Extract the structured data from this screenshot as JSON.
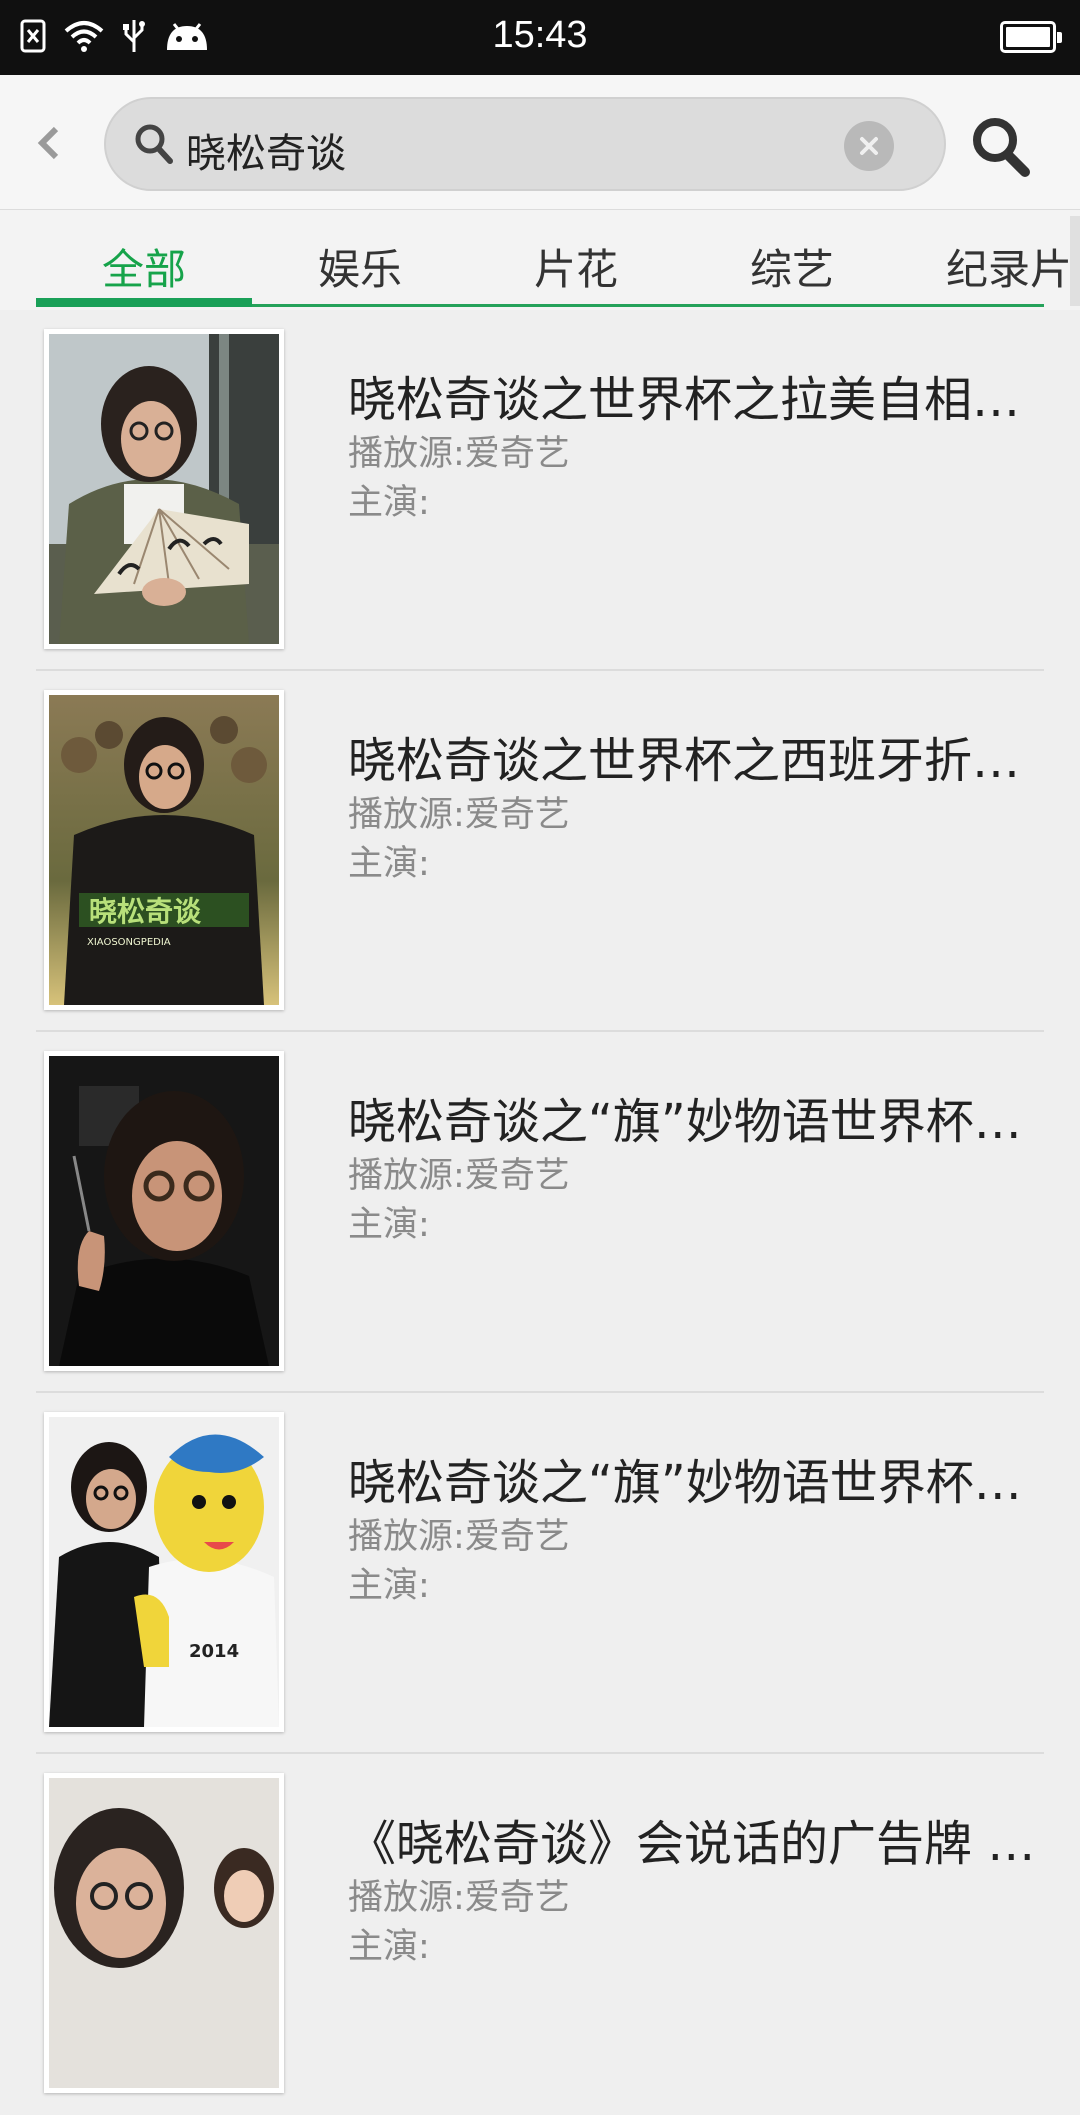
{
  "status_bar": {
    "time": "15:43",
    "icons": [
      "notification-blocked-icon",
      "wifi-icon",
      "usb-icon",
      "android-icon",
      "battery-icon"
    ]
  },
  "search": {
    "query": "晓松奇谈"
  },
  "tabs": [
    {
      "label": "全部",
      "active": true
    },
    {
      "label": "娱乐",
      "active": false
    },
    {
      "label": "片花",
      "active": false
    },
    {
      "label": "综艺",
      "active": false
    },
    {
      "label": "纪录片",
      "active": false
    }
  ],
  "results": [
    {
      "title": "晓松奇谈之世界杯之拉美自相…",
      "source": "播放源:爱奇艺",
      "cast": "主演:"
    },
    {
      "title": "晓松奇谈之世界杯之西班牙折…",
      "source": "播放源:爱奇艺",
      "cast": "主演:",
      "thumb_text": {
        "logo": "晓松奇谈",
        "sub": "XIAOSONGPEDIA"
      }
    },
    {
      "title": "晓松奇谈之“旗”妙物语世界杯…",
      "source": "播放源:爱奇艺",
      "cast": "主演:"
    },
    {
      "title": "晓松奇谈之“旗”妙物语世界杯…",
      "source": "播放源:爱奇艺",
      "cast": "主演:"
    },
    {
      "title": "《晓松奇谈》会说话的广告牌 …",
      "source": "播放源:爱奇艺",
      "cast": "主演:"
    }
  ],
  "colors": {
    "accent": "#1aa058",
    "status_bar": "#101010",
    "background": "#efefef"
  }
}
